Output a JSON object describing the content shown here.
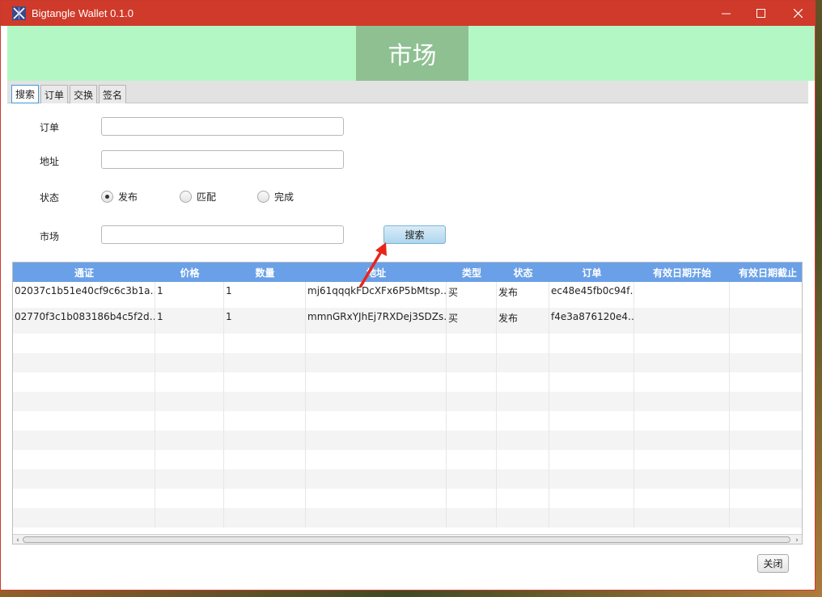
{
  "window": {
    "title": "Bigtangle  Wallet 0.1.0",
    "title_color": "#cf3a2b"
  },
  "icons": {
    "app": "app-logo-icon",
    "minimize": "minimize-icon",
    "maximize": "maximize-icon",
    "close": "close-icon",
    "arrow": "red-arrow-annotation"
  },
  "banner": {
    "title": "市场",
    "bg": "#b3f7c4",
    "box_bg": "#8fc092"
  },
  "tabs": [
    {
      "label": "搜索",
      "active": true
    },
    {
      "label": "订单",
      "active": false
    },
    {
      "label": "交换",
      "active": false
    },
    {
      "label": "签名",
      "active": false
    }
  ],
  "form": {
    "order_label": "订单",
    "order_value": "",
    "address_label": "地址",
    "address_value": "",
    "status_label": "状态",
    "status_options": [
      {
        "label": "发布",
        "checked": true
      },
      {
        "label": "匹配",
        "checked": false
      },
      {
        "label": "完成",
        "checked": false
      }
    ],
    "market_label": "市场",
    "market_value": "",
    "search_button": "搜索"
  },
  "table": {
    "header_color": "#6aa0e7",
    "columns": [
      "通证",
      "价格",
      "数量",
      "地址",
      "类型",
      "状态",
      "订单",
      "有效日期开始",
      "有效日期截止"
    ],
    "rows": [
      [
        "02037c1b51e40cf9c6c3b1a…",
        "1",
        "1",
        "mj61qqqkFDcXFx6P5bMtsp…",
        "买",
        "发布",
        "ec48e45fb0c94f…",
        "",
        ""
      ],
      [
        "02770f3c1b083186b4c5f2d…",
        "1",
        "1",
        "mmnGRxYJhEj7RXDej3SDZs…",
        "买",
        "发布",
        "f4e3a876120e4…",
        "",
        ""
      ]
    ]
  },
  "footer": {
    "close_button": "关闭"
  }
}
